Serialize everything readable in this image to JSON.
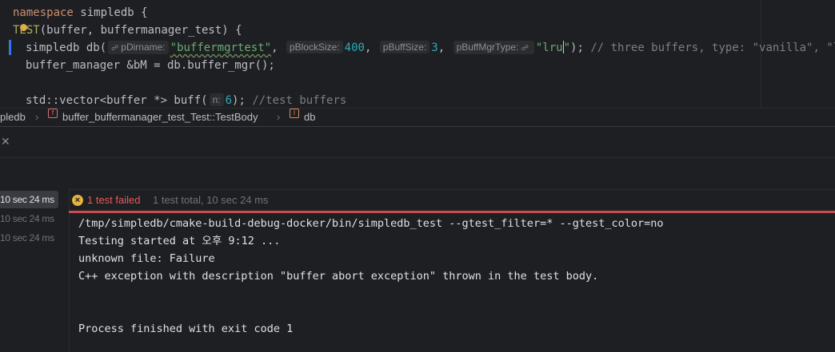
{
  "editor": {
    "line1": {
      "kw": "namespace",
      "rest": " simpledb {"
    },
    "line2": {
      "macro": "TEST",
      "rest": "(buffer, buffermanager_test) {"
    },
    "line3": {
      "prefix": "simpledb db(",
      "hint1": "pDirname:",
      "arg1": "\"buffermgrtest\"",
      "sep1": ", ",
      "hint2": "pBlockSize:",
      "arg2": "400",
      "sep2": ", ",
      "hint3": "pBuffSize:",
      "arg3": "3",
      "sep3": ", ",
      "hint4": "pBuffMgrType:",
      "arg4a": "\"lru",
      "arg4b": "\"",
      "after": "); ",
      "comment": "// three buffers, type: \"vanilla\", \"lru\""
    },
    "line4": "buffer_manager &bM = db.buffer_mgr();",
    "line6": {
      "prefix": "std::vector<buffer *> buff(",
      "hint": "n:",
      "arg": "6",
      "after": "); ",
      "comment": "//test buffers"
    }
  },
  "breadcrumb": {
    "item1": "pledb",
    "item2": "buffer_buffermanager_test_Test::TestBody",
    "item3": "db",
    "badge_f": "f",
    "badge_l": "l"
  },
  "tests": {
    "times": [
      "10 sec 24 ms",
      "10 sec 24 ms",
      "10 sec 24 ms"
    ],
    "status_failed": "1 test failed",
    "status_total": "1 test total, 10 sec 24 ms"
  },
  "console": {
    "lines": [
      "/tmp/simpledb/cmake-build-debug-docker/bin/simpledb_test --gtest_filter=* --gtest_color=no",
      "Testing started at 오후 9:12 ...",
      "unknown file: Failure",
      "C++ exception with description \"buffer abort exception\" thrown in the test body.",
      "Process finished with exit code 1"
    ]
  },
  "colors": {
    "accent": "#3574f0",
    "error": "#e55b5b",
    "warning": "#e3b341"
  }
}
